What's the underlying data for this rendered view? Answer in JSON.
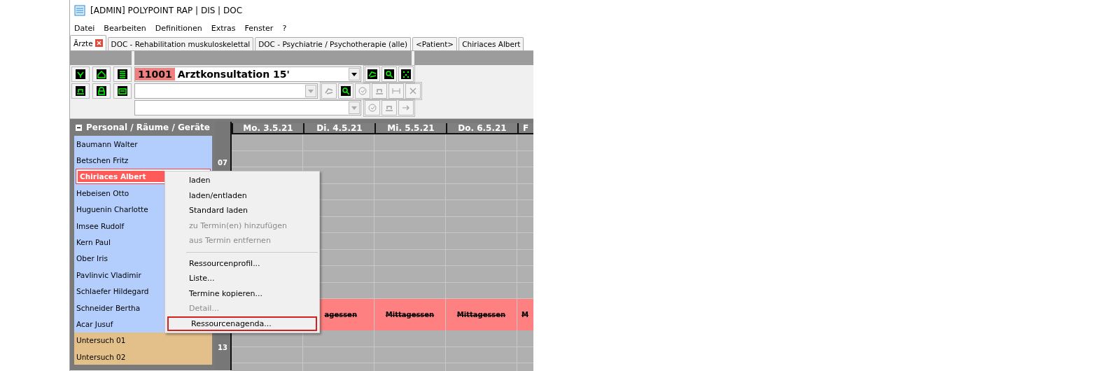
{
  "window": {
    "title": "[ADMIN] POLYPOINT RAP | DIS | DOC"
  },
  "menu_bar": [
    "Datei",
    "Bearbeiten",
    "Definitionen",
    "Extras",
    "Fenster",
    "?"
  ],
  "tabs": [
    {
      "label": "Ärzte",
      "selected": true,
      "closable": true
    },
    {
      "label": "DOC - Rehabilitation muskuloskelettal",
      "selected": false,
      "closable": false
    },
    {
      "label": "DOC - Psychiatrie / Psychotherapie (alle)",
      "selected": false,
      "closable": false
    },
    {
      "label": "<Patient>",
      "selected": false,
      "closable": false
    },
    {
      "label": "Chiriaces Albert",
      "selected": false,
      "closable": false
    }
  ],
  "toolbar": {
    "rows": [
      {
        "combo": {
          "code": "11001",
          "value": "Arztkonsultation 15'",
          "disabled": false
        },
        "right_icons": [
          {
            "disabled": false
          },
          {
            "disabled": false
          },
          {
            "disabled": false
          }
        ]
      },
      {
        "combo": {
          "disabled": true
        },
        "right_icons": [
          {
            "disabled": true
          },
          {
            "disabled": false
          },
          {
            "disabled": true
          },
          {
            "disabled": true
          },
          {
            "disabled": true
          },
          {
            "disabled": true
          }
        ]
      },
      {
        "combo": {
          "disabled": true
        },
        "right_icons": [
          {
            "disabled": true
          },
          {
            "disabled": true
          },
          {
            "disabled": true
          }
        ]
      }
    ]
  },
  "sidebar": {
    "title": "Personal / Räume / Geräte",
    "items": [
      {
        "label": "Baumann Walter",
        "color": "#b3cdfd",
        "selected": false
      },
      {
        "label": "Betschen Fritz",
        "color": "#b3cdfd",
        "selected": false
      },
      {
        "label": "Chiriaces Albert",
        "selected": true
      },
      {
        "label": "Hebeisen Otto",
        "color": "#b3cdfd",
        "selected": false
      },
      {
        "label": "Huguenin Charlotte",
        "color": "#b3cdfd",
        "selected": false
      },
      {
        "label": "Imsee Rudolf",
        "color": "#b3cdfd",
        "selected": false
      },
      {
        "label": "Kern Paul",
        "color": "#b3cdfd",
        "selected": false
      },
      {
        "label": "Ober Iris",
        "color": "#b3cdfd",
        "selected": false
      },
      {
        "label": "Pavlinvic Vladimir",
        "color": "#b3cdfd",
        "selected": false
      },
      {
        "label": "Schlaefer Hildegard",
        "color": "#b3cdfd",
        "selected": false
      },
      {
        "label": "Schneider Bertha",
        "color": "#b3cdfd",
        "selected": false
      },
      {
        "label": "Acar Jusuf",
        "color": "#b3cdfd",
        "selected": false
      },
      {
        "label": "Untersuch 01",
        "color": "#e3bf8a",
        "selected": false
      },
      {
        "label": "Untersuch 02",
        "color": "#e3bf8a",
        "selected": false
      }
    ]
  },
  "calendar": {
    "days": [
      "Mo. 3.5.21",
      "Di. 4.5.21",
      "Mi. 5.5.21",
      "Do. 6.5.21",
      "F"
    ],
    "hours": [
      "07",
      "13"
    ],
    "lunch": [
      "agessen",
      "Mittagessen",
      "Mittagessen",
      "M"
    ]
  },
  "context_menu": {
    "items": [
      {
        "kind": "item",
        "label": "laden",
        "disabled": false,
        "selected": false
      },
      {
        "kind": "item",
        "label": "laden/entladen",
        "disabled": false,
        "selected": false
      },
      {
        "kind": "item",
        "label": "Standard laden",
        "disabled": false,
        "selected": false
      },
      {
        "kind": "item",
        "label": "zu Termin(en) hinzufügen",
        "disabled": true,
        "selected": false
      },
      {
        "kind": "item",
        "label": "aus Termin entfernen",
        "disabled": true,
        "selected": false
      },
      {
        "kind": "separator"
      },
      {
        "kind": "item",
        "label": "Ressourcenprofil...",
        "disabled": false,
        "selected": false
      },
      {
        "kind": "item",
        "label": "Liste...",
        "disabled": false,
        "selected": false
      },
      {
        "kind": "item",
        "label": "Termine kopieren...",
        "disabled": false,
        "selected": false
      },
      {
        "kind": "item",
        "label": "Detail...",
        "disabled": true,
        "selected": false
      },
      {
        "kind": "item",
        "label": "Ressourcenagenda...",
        "disabled": false,
        "selected": true
      }
    ]
  }
}
